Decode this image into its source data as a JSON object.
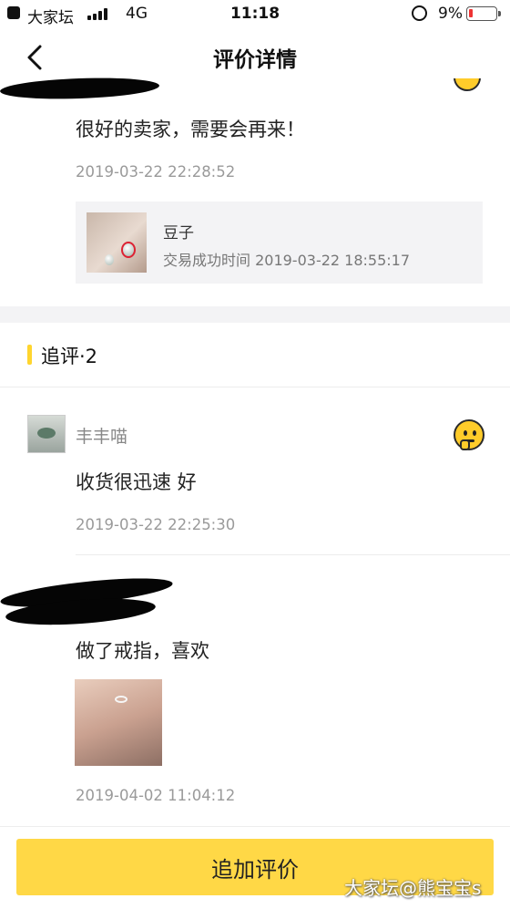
{
  "status_bar": {
    "carrier": "大家坛",
    "network": "4G",
    "time": "11:18",
    "battery": "9%",
    "battery_level": 0.09
  },
  "nav": {
    "title": "评价详情"
  },
  "review": {
    "content": "很好的卖家，需要会再来！",
    "date": "2019-03-22 22:28:52",
    "order": {
      "name": "豆子",
      "time_label": "交易成功时间 2019-03-22 18:55:17"
    }
  },
  "follow_up": {
    "title": "追评·2",
    "items": [
      {
        "username": "丰丰喵",
        "content": "收货很迅速 好",
        "date": "2019-03-22 22:25:30"
      },
      {
        "username": "",
        "content": "做了戒指，喜欢",
        "date": "2019-04-02 11:04:12"
      }
    ]
  },
  "bottom": {
    "button_label": "追加评价"
  },
  "watermark": "大家坛@熊宝宝s",
  "colors": {
    "accent": "#ffd846",
    "section_bar": "#ffd52e",
    "gap": "#f3f3f5"
  },
  "icons": [
    "back-arrow-icon",
    "signal-icon",
    "rotation-lock-icon",
    "battery-icon",
    "thinking-emoji-icon"
  ]
}
